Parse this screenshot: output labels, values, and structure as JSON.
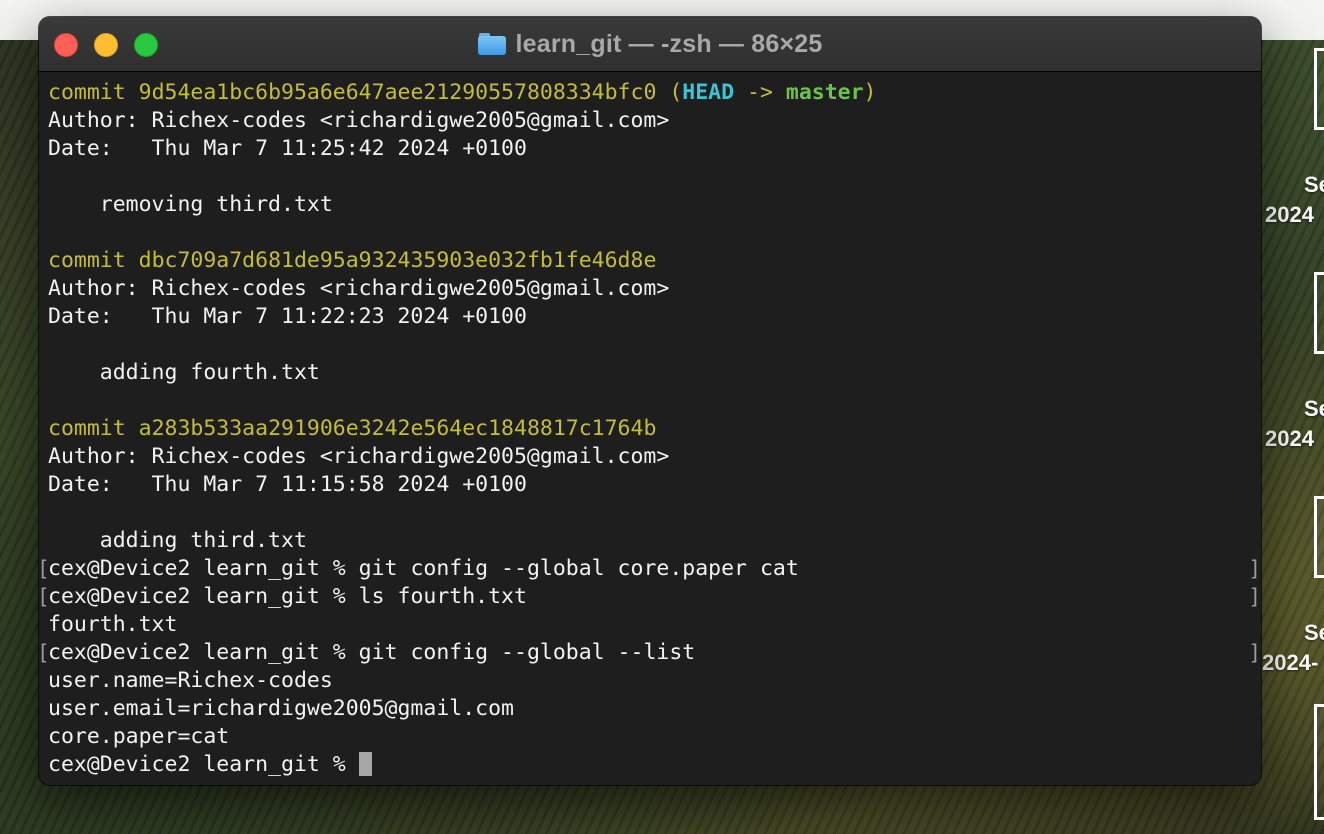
{
  "window": {
    "title": "learn_git — -zsh — 86×25"
  },
  "desktop": {
    "labels": [
      "Se",
      "2024",
      "Se",
      "2024",
      "Se",
      "2024-"
    ]
  },
  "terminal": {
    "commits": [
      {
        "commit_word": "commit",
        "hash": "9d54ea1bc6b95a6e647aee21290557808334bfc0",
        "ref_open": "(",
        "ref_head": "HEAD",
        "ref_arrow": "->",
        "ref_branch": "master",
        "ref_close": ")",
        "author": "Author: Richex-codes <richardigwe2005@gmail.com>",
        "date": "Date:   Thu Mar 7 11:25:42 2024 +0100",
        "message": "    removing third.txt"
      },
      {
        "commit_word": "commit",
        "hash": "dbc709a7d681de95a932435903e032fb1fe46d8e",
        "author": "Author: Richex-codes <richardigwe2005@gmail.com>",
        "date": "Date:   Thu Mar 7 11:22:23 2024 +0100",
        "message": "    adding fourth.txt"
      },
      {
        "commit_word": "commit",
        "hash": "a283b533aa291906e3242e564ec1848817c1764b",
        "author": "Author: Richex-codes <richardigwe2005@gmail.com>",
        "date": "Date:   Thu Mar 7 11:15:58 2024 +0100",
        "message": "    adding third.txt"
      }
    ],
    "prompt": "cex@Device2 learn_git % ",
    "cmd1": "git config --global core.paper cat",
    "cmd2": "ls fourth.txt",
    "out2": "fourth.txt",
    "cmd3": "git config --global --list",
    "out3": [
      "user.name=Richex-codes",
      "user.email=richardigwe2005@gmail.com",
      "core.paper=cat"
    ],
    "bracket_open": "[",
    "bracket_close": "]"
  }
}
